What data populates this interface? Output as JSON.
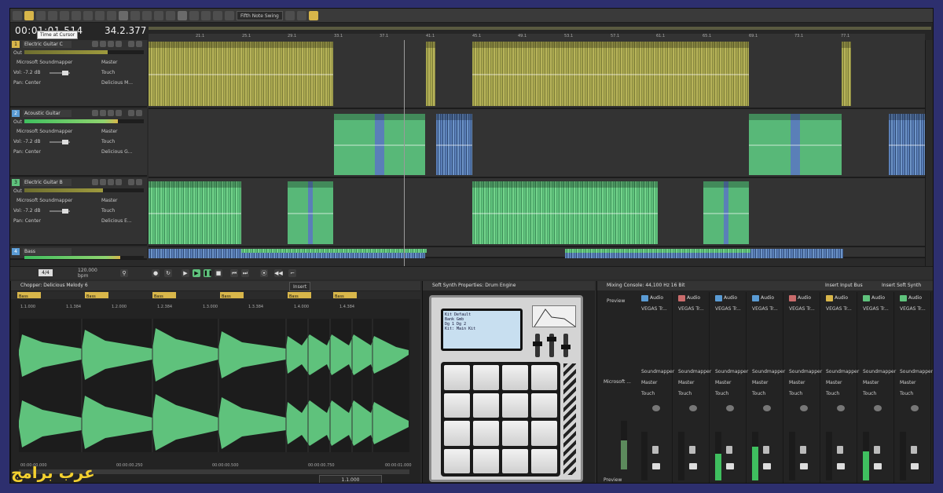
{
  "toolbar": {
    "snap_label": "Fifth Note Swing"
  },
  "timeline": {
    "cursor_time": "00:01:01.514",
    "tooltip": "Time at Cursor",
    "position": "34.2.377",
    "ruler": [
      "21.1",
      "25.1",
      "29.1",
      "33.1",
      "37.1",
      "41.1",
      "45.1",
      "49.1",
      "53.1",
      "57.1",
      "61.1",
      "65.1",
      "69.1",
      "73.1",
      "77.1"
    ]
  },
  "tracks": [
    {
      "num": "1",
      "name": "Electric Guitar C",
      "color": "#d8b64a",
      "out": "Out",
      "device": "Microsoft Soundmapper",
      "bus": "Master",
      "vol": "Vol: -7.2 dB",
      "pan": "Pan: Center",
      "touch": "Touch",
      "fx": "Delicious M..."
    },
    {
      "num": "2",
      "name": "Acoustic Guitar",
      "color": "#5a9bd4",
      "out": "Out",
      "device": "Microsoft Soundmapper",
      "bus": "Master",
      "vol": "Vol: -7.2 dB",
      "pan": "Pan: Center",
      "touch": "Touch",
      "fx": "Delicious G..."
    },
    {
      "num": "3",
      "name": "Electric Guitar B",
      "color": "#5fc27c",
      "out": "Out",
      "device": "Microsoft Soundmapper",
      "bus": "Master",
      "vol": "Vol: -7.2 dB",
      "pan": "Pan: Center",
      "touch": "Touch",
      "fx": "Delicious E..."
    },
    {
      "num": "4",
      "name": "Bass",
      "color": "#5a9bd4"
    }
  ],
  "transport": {
    "rate_a": "120.000",
    "rate_b": "bpm",
    "rate_c": "4/4"
  },
  "chopper": {
    "title": "Chopper: Delicious Melody 6",
    "insert": "Insert",
    "marker": "Bass",
    "beats": [
      "1.1.000",
      "1.1.384",
      "1.2.000",
      "1.2.384",
      "1.3.000",
      "1.3.384",
      "1.4.000",
      "1.4.384"
    ],
    "footer": "1.1.000",
    "footer_times": [
      "00:00:00.000",
      "00:00:00.250",
      "00:00:00.500",
      "00:00:00.750",
      "00:00:01.000"
    ]
  },
  "synth": {
    "title": "Soft Synth Properties: Drum Engine",
    "lcd": [
      "Kit  Default",
      "Bank Gmb",
      "Dg 1  Dg 2",
      "Kit: Main Kit"
    ]
  },
  "mixer": {
    "title": "Mixing Console: 44,100 Hz 16 Bit",
    "insert_bus": "Insert Input Bus",
    "insert_synth": "Insert Soft Synth",
    "preview": "Preview",
    "device": "Microsoft ...",
    "strips": [
      {
        "type": "Audio",
        "color": "#5a9bd4",
        "name": "Chorus",
        "out": "VEGAS Tr...",
        "map": "Soundmapper",
        "bus": "Master",
        "touch": "Touch",
        "level": 0.0
      },
      {
        "type": "Audio",
        "color": "#c96b6b",
        "name": "Choir",
        "out": "VEGAS Tr...",
        "map": "Soundmapper",
        "bus": "Master",
        "touch": "Touch",
        "level": 0.0
      },
      {
        "type": "Audio",
        "color": "#5a9bd4",
        "name": "Drums",
        "out": "VEGAS Tr...",
        "map": "Soundmapper",
        "bus": "Master",
        "touch": "Touch",
        "level": 0.55
      },
      {
        "type": "Audio",
        "color": "#5a9bd4",
        "name": "Drums H",
        "out": "VEGAS Tr...",
        "map": "Soundmapper",
        "bus": "Master",
        "touch": "Touch",
        "level": 0.7
      },
      {
        "type": "Audio",
        "color": "#c96b6b",
        "name": "Drums 1",
        "out": "VEGAS Tr...",
        "map": "Soundmapper",
        "bus": "Master",
        "touch": "Touch",
        "level": 0.0
      },
      {
        "type": "Audio",
        "color": "#d8b64a",
        "name": "Electric Gui...",
        "out": "VEGAS Tr...",
        "map": "Soundmapper",
        "bus": "Master",
        "touch": "Touch",
        "level": 0.0
      },
      {
        "type": "Audio",
        "color": "#5fc27c",
        "name": "Acoustic G...",
        "out": "VEGAS Tr...",
        "map": "Soundmapper",
        "bus": "Master",
        "touch": "Touch",
        "level": 0.6
      },
      {
        "type": "Audio",
        "color": "#5fc27c",
        "name": "Electric Gui...",
        "out": "VEGAS Tr...",
        "map": "Soundmapper",
        "bus": "Master",
        "touch": "Touch",
        "level": 0.0
      }
    ]
  },
  "watermark": "عرب برامج"
}
